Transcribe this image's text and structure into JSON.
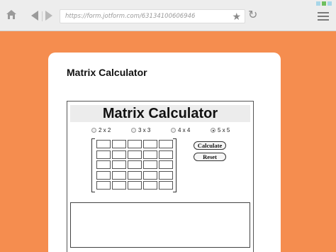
{
  "browser": {
    "url": "https://form.jotform.com/63134100606946",
    "icons": [
      "home-icon",
      "back-icon",
      "forward-icon",
      "star-icon",
      "reload-icon",
      "menu-icon"
    ],
    "window_dot_colors": [
      "#a8d6e8",
      "#6fbf5f",
      "#a8d6e8"
    ]
  },
  "card": {
    "title": "Matrix Calculator"
  },
  "calculator": {
    "banner": "Matrix Calculator",
    "sizes": [
      {
        "label": "2 x 2",
        "selected": false
      },
      {
        "label": "3 x 3",
        "selected": false
      },
      {
        "label": "4 x 4",
        "selected": false
      },
      {
        "label": "5 x 5",
        "selected": true
      }
    ],
    "calculate_label": "Calculate",
    "reset_label": "Reset",
    "rows": 5,
    "cols": 5
  },
  "colors": {
    "page_background": "#f58d4f",
    "card_background": "#ffffff"
  }
}
